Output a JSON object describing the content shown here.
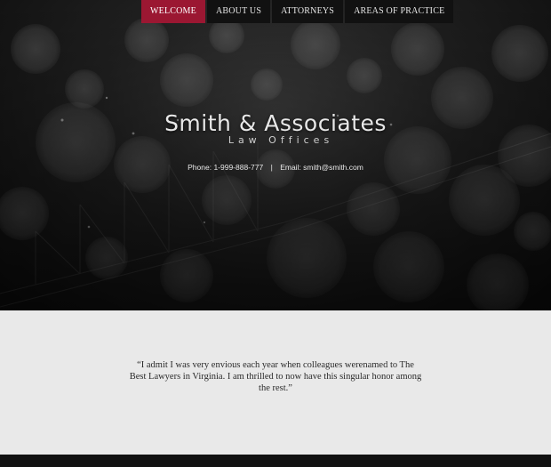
{
  "nav": {
    "items": [
      {
        "label": "WELCOME",
        "active": true
      },
      {
        "label": "ABOUT US",
        "active": false
      },
      {
        "label": "ATTORNEYS",
        "active": false
      },
      {
        "label": "AREAS OF PRACTICE",
        "active": false
      }
    ]
  },
  "hero": {
    "title": "Smith & Associates",
    "subtitle": "Law Offices",
    "phone": "Phone: 1-999-888-777",
    "separator": "|",
    "email": "Email: smith@smith.com"
  },
  "testimonial": {
    "quote": "“I admit I was very envious each year when colleagues werenamed to The Best Lawyers in Virginia. I am thrilled to now have this singular honor among the rest.”"
  },
  "colors": {
    "accent": "#9b1732",
    "nav_bg": "#111111",
    "quote_bg": "#e9e9e9"
  }
}
